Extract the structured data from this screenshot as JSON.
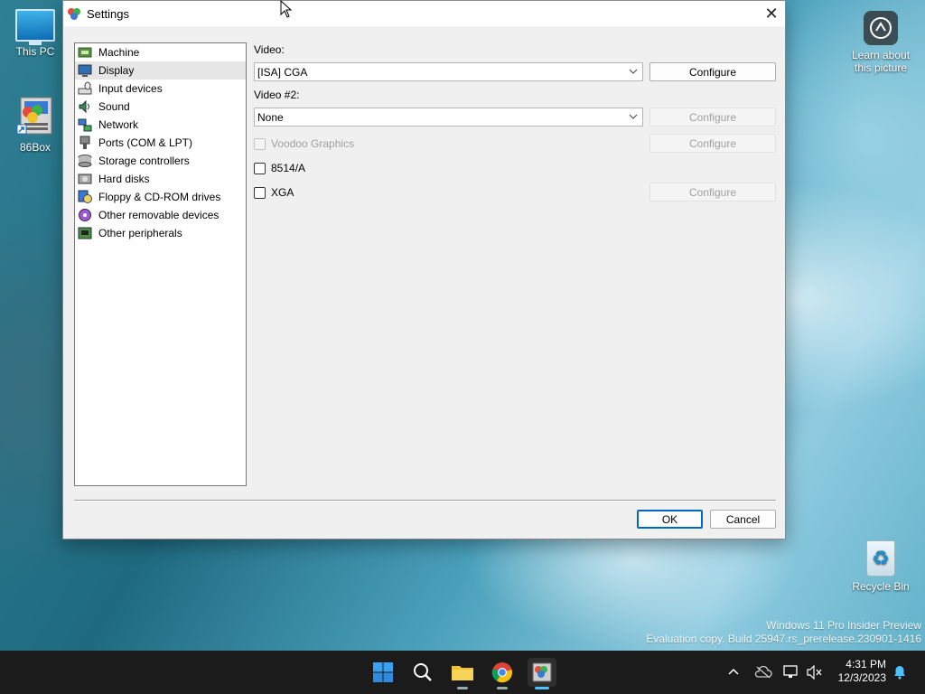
{
  "desktop": {
    "icons": {
      "this_pc": "This PC",
      "box86": "86Box",
      "learn": "Learn about this picture",
      "recycle_bin": "Recycle Bin"
    },
    "watermark": {
      "line1": "Windows 11 Pro Insider Preview",
      "line2": "Evaluation copy. Build 25947.rs_prerelease.230901-1416"
    }
  },
  "window": {
    "title": "Settings",
    "close_glyph": "✕"
  },
  "categories": [
    {
      "label": "Machine",
      "icon": "machine-icon",
      "selected": false
    },
    {
      "label": "Display",
      "icon": "display-icon",
      "selected": true
    },
    {
      "label": "Input devices",
      "icon": "input-devices-icon",
      "selected": false
    },
    {
      "label": "Sound",
      "icon": "sound-icon",
      "selected": false
    },
    {
      "label": "Network",
      "icon": "network-icon",
      "selected": false
    },
    {
      "label": "Ports (COM & LPT)",
      "icon": "ports-icon",
      "selected": false
    },
    {
      "label": "Storage controllers",
      "icon": "storage-controllers-icon",
      "selected": false
    },
    {
      "label": "Hard disks",
      "icon": "hard-disks-icon",
      "selected": false
    },
    {
      "label": "Floppy & CD-ROM drives",
      "icon": "floppy-cdrom-icon",
      "selected": false
    },
    {
      "label": "Other removable devices",
      "icon": "removable-devices-icon",
      "selected": false
    },
    {
      "label": "Other peripherals",
      "icon": "peripherals-icon",
      "selected": false
    }
  ],
  "display": {
    "video_label": "Video:",
    "video_value": "[ISA] CGA",
    "video_configure": "Configure",
    "video2_label": "Video #2:",
    "video2_value": "None",
    "video2_configure": "Configure",
    "voodoo_label": "Voodoo Graphics",
    "voodoo_checked": false,
    "voodoo_enabled": false,
    "voodoo_configure": "Configure",
    "ibm8514_label": "8514/A",
    "ibm8514_checked": false,
    "xga_label": "XGA",
    "xga_checked": false,
    "xga_configure": "Configure"
  },
  "footer": {
    "ok": "OK",
    "cancel": "Cancel"
  },
  "taskbar": {
    "time": "4:31 PM",
    "date": "12/3/2023",
    "apps": [
      "start-icon",
      "search-icon",
      "file-explorer-icon",
      "chrome-icon",
      "86box-icon"
    ]
  },
  "colors": {
    "accent": "#0067c0",
    "taskbar_bg": "#1b1b1b",
    "window_bg": "#f0f0f0"
  }
}
